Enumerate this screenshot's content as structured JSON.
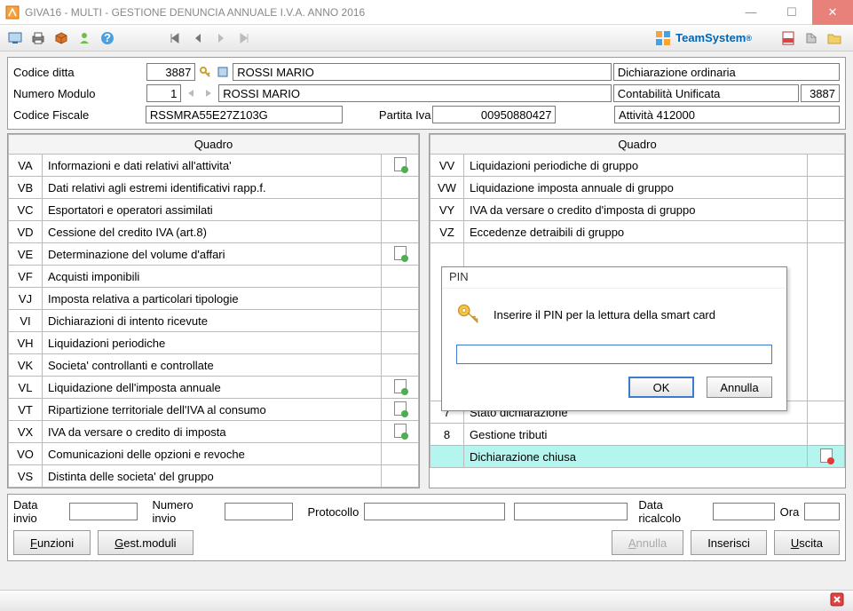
{
  "window": {
    "title": "GIVA16  - MULTI -   GESTIONE DENUNCIA ANNUALE I.V.A. ANNO 2016"
  },
  "brand": "TeamSystem",
  "header": {
    "codice_ditta_lbl": "Codice ditta",
    "codice_ditta_val": "3887",
    "nome1": "ROSSI MARIO",
    "dichiarazione": "Dichiarazione ordinaria",
    "numero_modulo_lbl": "Numero Modulo",
    "numero_modulo_val": "1",
    "nome2": "ROSSI MARIO",
    "contabilita": "Contabilità Unificata",
    "cont_val": "3887",
    "codice_fiscale_lbl": "Codice Fiscale",
    "codice_fiscale_val": "RSSMRA55E27Z103G",
    "partita_iva_lbl": "Partita Iva",
    "partita_iva_val": "00950880427",
    "attivita": "Attività 412000"
  },
  "col_header": "Quadro",
  "left_rows": [
    {
      "code": "VA",
      "desc": "Informazioni e dati relativi all'attivita'",
      "icon": "doc"
    },
    {
      "code": "VB",
      "desc": "Dati relativi agli estremi identificativi rapp.f."
    },
    {
      "code": "VC",
      "desc": "Esportatori e operatori assimilati"
    },
    {
      "code": "VD",
      "desc": "Cessione del credito IVA (art.8)"
    },
    {
      "code": "VE",
      "desc": "Determinazione del volume d'affari",
      "icon": "doc"
    },
    {
      "code": "VF",
      "desc": "Acquisti imponibili"
    },
    {
      "code": "VJ",
      "desc": "Imposta relativa a particolari tipologie"
    },
    {
      "code": "VI",
      "desc": "Dichiarazioni di intento ricevute"
    },
    {
      "code": "VH",
      "desc": "Liquidazioni periodiche"
    },
    {
      "code": "VK",
      "desc": "Societa' controllanti e controllate"
    },
    {
      "code": "VL",
      "desc": "Liquidazione dell'imposta annuale",
      "icon": "doc"
    },
    {
      "code": "VT",
      "desc": "Ripartizione territoriale dell'IVA al consumo",
      "icon": "doc"
    },
    {
      "code": "VX",
      "desc": "IVA da versare o credito di imposta",
      "icon": "doc"
    },
    {
      "code": "VO",
      "desc": "Comunicazioni delle opzioni e revoche"
    },
    {
      "code": "VS",
      "desc": "Distinta delle societa' del gruppo"
    }
  ],
  "right_rows_top": [
    {
      "code": "VV",
      "desc": "Liquidazioni periodiche di gruppo"
    },
    {
      "code": "VW",
      "desc": "Liquidazione imposta annuale di gruppo"
    },
    {
      "code": "VY",
      "desc": "IVA da versare o credito d'imposta di gruppo"
    },
    {
      "code": "VZ",
      "desc": "Eccedenze detraibili di gruppo"
    }
  ],
  "right_rows_bottom": [
    {
      "code": "7",
      "desc": "Stato dichiarazione"
    },
    {
      "code": "8",
      "desc": "Gestione tributi"
    },
    {
      "code": "",
      "desc": "Dichiarazione chiusa",
      "icon": "doc-red",
      "hl": true
    }
  ],
  "footer": {
    "data_invio_lbl": "Data invio",
    "numero_invio_lbl": "Numero invio",
    "protocollo_lbl": "Protocollo",
    "data_ricalcolo_lbl": "Data ricalcolo",
    "ora_lbl": "Ora"
  },
  "buttons": {
    "funzioni": "Funzioni",
    "gest_moduli": "Gest.moduli",
    "annulla": "Annulla",
    "inserisci": "Inserisci",
    "uscita": "Uscita"
  },
  "dialog": {
    "title": "PIN",
    "message": "Inserire il PIN per la lettura della smart card",
    "ok": "OK",
    "cancel": "Annulla"
  }
}
